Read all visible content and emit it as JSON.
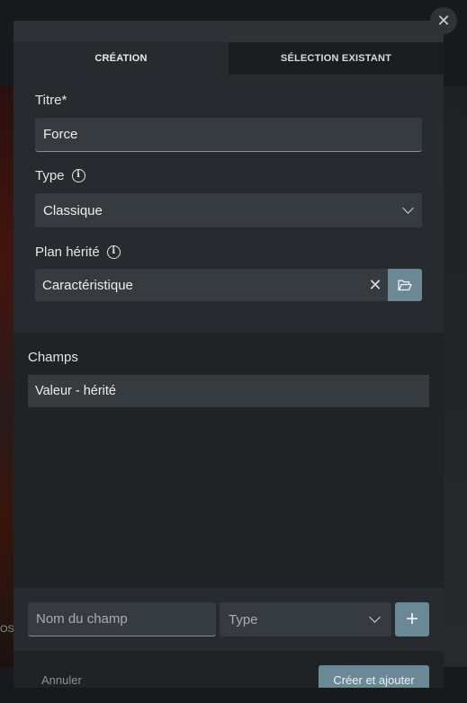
{
  "tabs": [
    {
      "label": "CRÉATION",
      "active": true
    },
    {
      "label": "SÉLECTION EXISTANT",
      "active": false
    }
  ],
  "form": {
    "title_label": "Titre*",
    "title_value": "Force",
    "type_label": "Type",
    "type_value": "Classique",
    "plan_label": "Plan hérité",
    "plan_value": "Caractéristique"
  },
  "champs": {
    "title": "Champs",
    "items": [
      {
        "label": "Valeur - hérité"
      }
    ]
  },
  "add_field": {
    "name_placeholder": "Nom du champ",
    "type_placeholder": "Type"
  },
  "footer": {
    "cancel_label": "Annuler",
    "submit_label": "Créer et ajouter"
  },
  "background": {
    "cut_text": "OSL"
  },
  "icons": {
    "close": "close-icon",
    "info": "info-icon",
    "chevron": "chevron-down-icon",
    "clear": "clear-icon",
    "folder": "folder-open-icon",
    "plus": "plus-icon"
  },
  "colors": {
    "accent": "#6b8896",
    "surface": "#272b2f",
    "input": "#363b40"
  }
}
